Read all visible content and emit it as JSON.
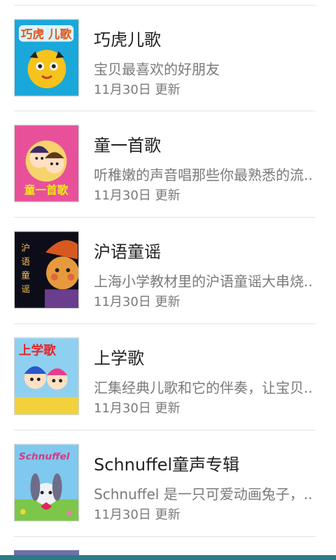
{
  "items": [
    {
      "title": "巧虎儿歌",
      "desc": "宝贝最喜欢的好朋友",
      "date": "11月30日 更新",
      "thumb_text": "巧虎 儿歌"
    },
    {
      "title": "童一首歌",
      "desc": "听稚嫩的声音唱那些你最熟悉的流...",
      "date": "11月30日 更新",
      "thumb_text": "童一首歌"
    },
    {
      "title": "沪语童谣",
      "desc": "上海小学教材里的沪语童谣大串烧...",
      "date": "11月30日 更新",
      "thumb_text": "沪语童谣"
    },
    {
      "title": "上学歌",
      "desc": "汇集经典儿歌和它的伴奏，让宝贝...",
      "date": "11月30日 更新",
      "thumb_text": "上学歌"
    },
    {
      "title": "Schnuffel童声专辑",
      "desc": "Schnuffel 是一只可爱动画兔子，...",
      "date": "11月30日 更新",
      "thumb_text": "Schnuffel"
    }
  ]
}
